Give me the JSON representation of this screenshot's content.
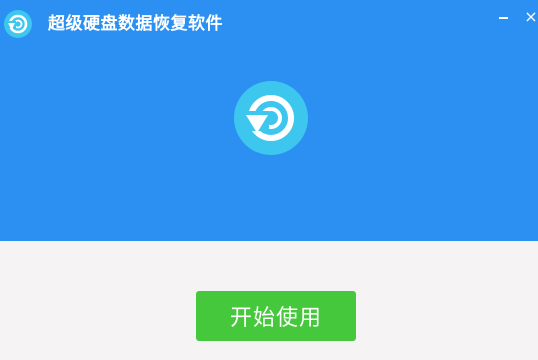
{
  "window": {
    "title": "超级硬盘数据恢复软件",
    "icons": {
      "app": "restore-icon",
      "minimize": "minimize-icon",
      "close": "close-icon",
      "logo": "restore-logo-icon"
    },
    "close_glyph": "×"
  },
  "main": {
    "start_button_label": "开始使用"
  },
  "colors": {
    "header_bg": "#2b90f2",
    "content_bg": "#f5f3f4",
    "logo_circle": "#3dc7ee",
    "button_bg": "#45c83b",
    "text_light": "#ffffff"
  }
}
